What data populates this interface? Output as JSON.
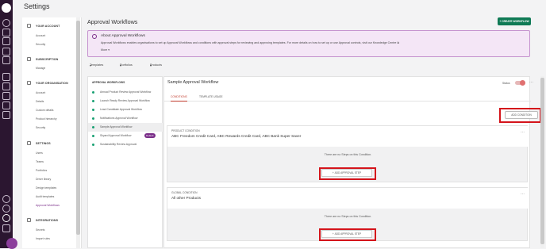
{
  "app": {
    "title": "Settings"
  },
  "rail_icons": [
    "logo-icon",
    "user-icon",
    "document-icon",
    "calendar-icon",
    "list-icon",
    "chart-icon",
    "home-icon",
    "grid-icon",
    "folder-icon",
    "book-icon",
    "table-icon",
    "bell-icon",
    "help-icon",
    "gear-icon",
    "logout-icon"
  ],
  "sidebar": {
    "groups": [
      {
        "label": "YOUR ACCOUNT",
        "items": [
          "Account",
          "Security"
        ]
      },
      {
        "label": "SUBSCRIPTION",
        "items": [
          "Manage"
        ]
      },
      {
        "label": "YOUR ORGANISATION",
        "items": [
          "Account",
          "Details",
          "Custom details",
          "Product hierarchy",
          "Security"
        ]
      },
      {
        "label": "SETTINGS",
        "items": [
          "Users",
          "Teams",
          "Portfolios",
          "Driver library",
          "Design templates",
          "Audit templates",
          "Approval Workflows"
        ]
      },
      {
        "label": "INTEGRATIONS",
        "items": [
          "Secrets",
          "Import rules"
        ]
      }
    ]
  },
  "page": {
    "title": "Approval Workflows",
    "create_button": "+ CREATE WORKFLOW"
  },
  "about": {
    "title": "About Approval Workflows",
    "body": "Approval Workflows enables organisations to set up Approval Workflows and conditions with approval steps for reviewing and approving templates. For more details on how to set up or use Approval controls, visit our Knowledge Centre",
    "more": "More"
  },
  "filters": [
    "Templates",
    "Portfolios",
    "Products"
  ],
  "workflows": {
    "heading": "APPROVAL WORKFLOWS",
    "items": [
      {
        "label": "Annual Product Review Approval Workflow"
      },
      {
        "label": "Launch Ready Review Approval Workflow"
      },
      {
        "label": "Lead Candidate Approval Workflow"
      },
      {
        "label": "Notifications Approval Workflow"
      },
      {
        "label": "Sample Approval Workflow",
        "selected": true
      },
      {
        "label": "Skyard Approval Workflow",
        "badge": "Default"
      },
      {
        "label": "Sustainability Review Approval"
      }
    ]
  },
  "detail": {
    "title": "Sample Approval Workflow",
    "status_label": "Status",
    "tabs": [
      "CONDITIONS",
      "TEMPLATE USAGE"
    ],
    "add_condition": "ADD CONDITION",
    "conditions": [
      {
        "type": "PRODUCT CONDITION",
        "name": "ABC Freedom Credit Card, ABC Rewards Credit Card, ABC Bank Super Saver",
        "empty": "There are no Steps on this Condition.",
        "step_button": "ADD APPROVAL STEP"
      },
      {
        "type": "GLOBAL CONDITION",
        "name": "All other Products",
        "empty": "There are no Steps on this Condition.",
        "step_button": "ADD APPROVAL STEP"
      }
    ]
  },
  "colors": {
    "brand": "#2b1630",
    "accent": "#7a2e89",
    "create": "#0f7a55",
    "highlight": "#d4141b"
  }
}
